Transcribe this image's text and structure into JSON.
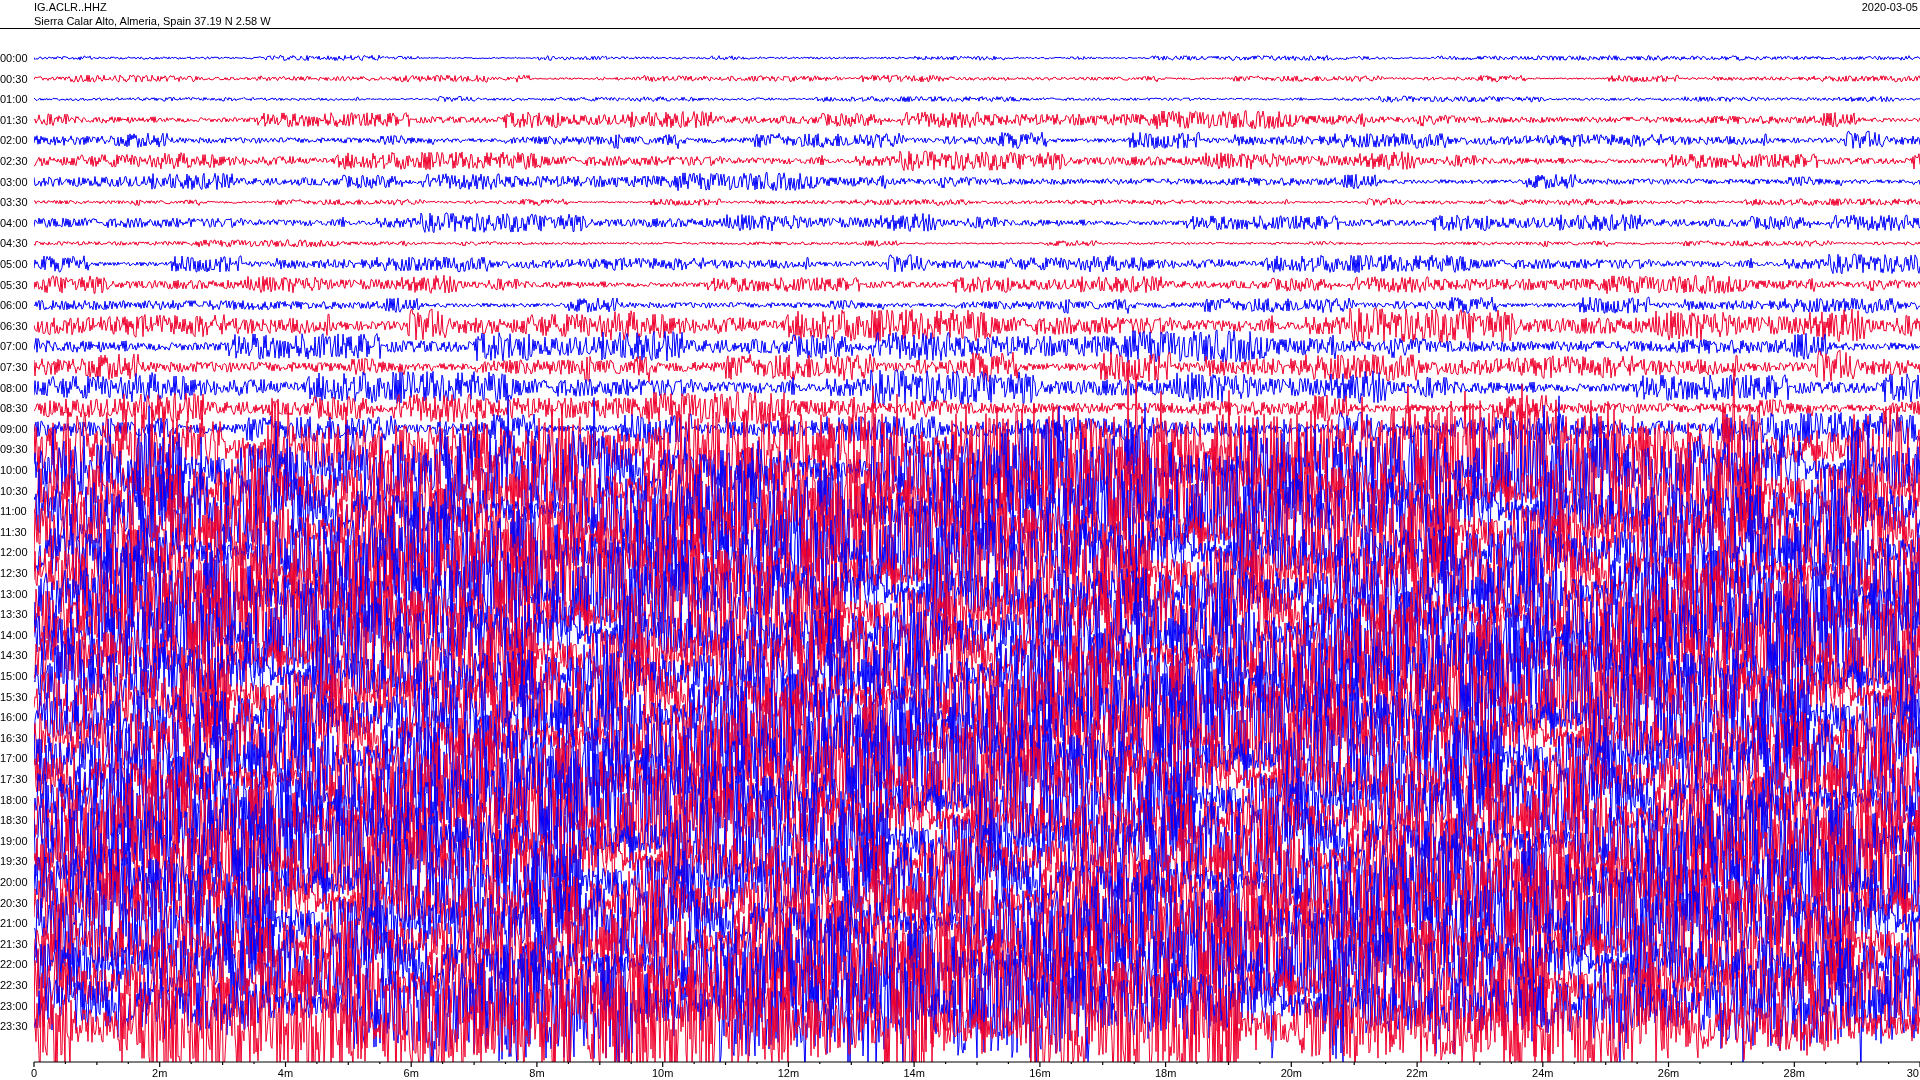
{
  "header": {
    "station": "IG.ACLR..HHZ",
    "location": "Sierra Calar Alto, Almeria, Spain  37.19 N 2.58 W",
    "date": "2020-03-05"
  },
  "helicorder": {
    "rows": [
      {
        "label": "00:00"
      },
      {
        "label": "00:30"
      },
      {
        "label": "01:00"
      },
      {
        "label": "01:30"
      },
      {
        "label": "02:00"
      },
      {
        "label": "02:30"
      },
      {
        "label": "03:00"
      },
      {
        "label": "03:30"
      },
      {
        "label": "04:00"
      },
      {
        "label": "04:30"
      },
      {
        "label": "05:00"
      },
      {
        "label": "05:30"
      },
      {
        "label": "06:00"
      },
      {
        "label": "06:30"
      },
      {
        "label": "07:00"
      },
      {
        "label": "07:30"
      },
      {
        "label": "08:00"
      },
      {
        "label": "08:30"
      },
      {
        "label": "09:00"
      },
      {
        "label": "09:30"
      },
      {
        "label": "10:00"
      },
      {
        "label": "10:30"
      },
      {
        "label": "11:00"
      },
      {
        "label": "11:30"
      },
      {
        "label": "12:00"
      },
      {
        "label": "12:30"
      },
      {
        "label": "13:00"
      },
      {
        "label": "13:30"
      },
      {
        "label": "14:00"
      },
      {
        "label": "14:30"
      },
      {
        "label": "15:00"
      },
      {
        "label": "15:30"
      },
      {
        "label": "16:00"
      },
      {
        "label": "16:30"
      },
      {
        "label": "17:00"
      },
      {
        "label": "17:30"
      },
      {
        "label": "18:00"
      },
      {
        "label": "18:30"
      },
      {
        "label": "19:00"
      },
      {
        "label": "19:30"
      },
      {
        "label": "20:00"
      },
      {
        "label": "20:30"
      },
      {
        "label": "21:00"
      },
      {
        "label": "21:30"
      },
      {
        "label": "22:00"
      },
      {
        "label": "22:30"
      },
      {
        "label": "23:00"
      },
      {
        "label": "23:30"
      }
    ],
    "x_axis_labels": [
      "0",
      "2m",
      "4m",
      "6m",
      "8m",
      "10m",
      "12m",
      "14m",
      "16m",
      "18m",
      "20m",
      "22m",
      "24m",
      "26m",
      "28m",
      "30"
    ]
  }
}
